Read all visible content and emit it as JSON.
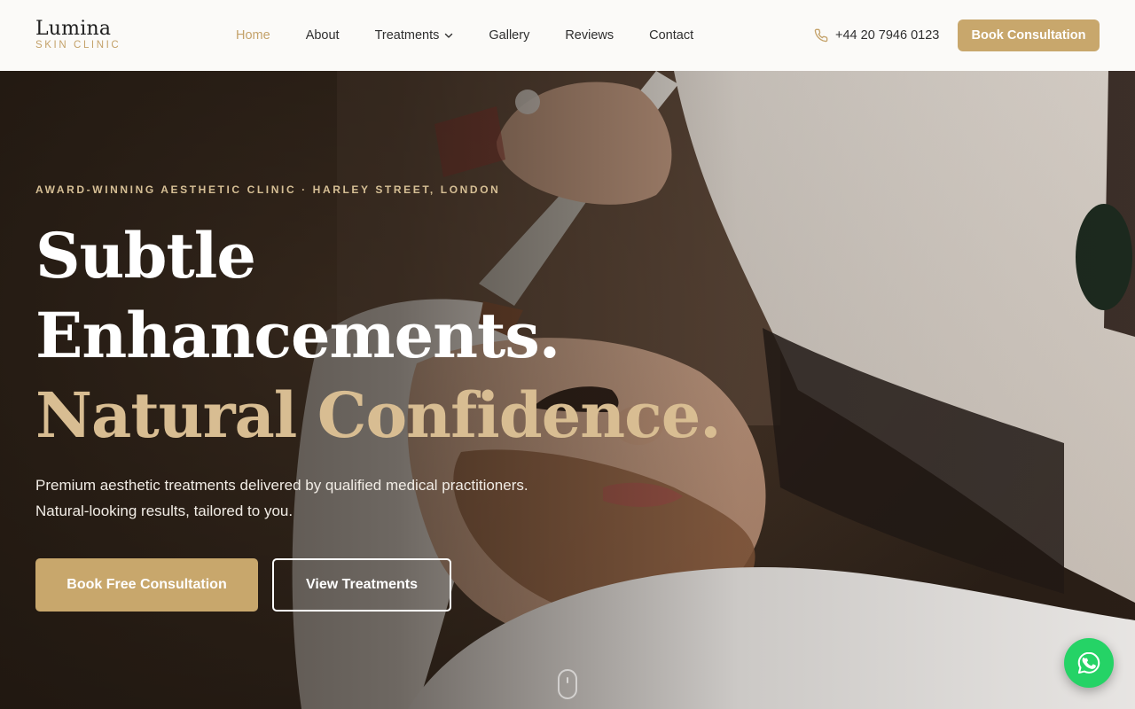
{
  "brand": {
    "name": "Lumina",
    "subtitle": "SKIN CLINIC"
  },
  "nav": {
    "items": [
      {
        "label": "Home",
        "active": true
      },
      {
        "label": "About"
      },
      {
        "label": "Treatments",
        "has_dropdown": true
      },
      {
        "label": "Gallery"
      },
      {
        "label": "Reviews"
      },
      {
        "label": "Contact"
      }
    ],
    "phone": "+44 20 7946 0123",
    "book_label": "Book Consultation"
  },
  "hero": {
    "eyebrow": "AWARD-WINNING AESTHETIC CLINIC · HARLEY STREET, LONDON",
    "headline_line1": "Subtle",
    "headline_line2": "Enhancements.",
    "headline_accent": "Natural Confidence.",
    "lead": "Premium aesthetic treatments delivered by qualified medical practitioners. Natural-looking results, tailored to you.",
    "primary_cta": "Book Free Consultation",
    "secondary_cta": "View Treatments"
  },
  "icons": {
    "phone": "phone-icon",
    "chevron": "chevron-down-icon",
    "scroll": "scroll-mouse-icon",
    "chat": "whatsapp-icon"
  },
  "colors": {
    "accent": "#c8a76c",
    "accent_text": "#c4a26a",
    "headline_accent": "#d8bd92",
    "whatsapp": "#25d366"
  }
}
